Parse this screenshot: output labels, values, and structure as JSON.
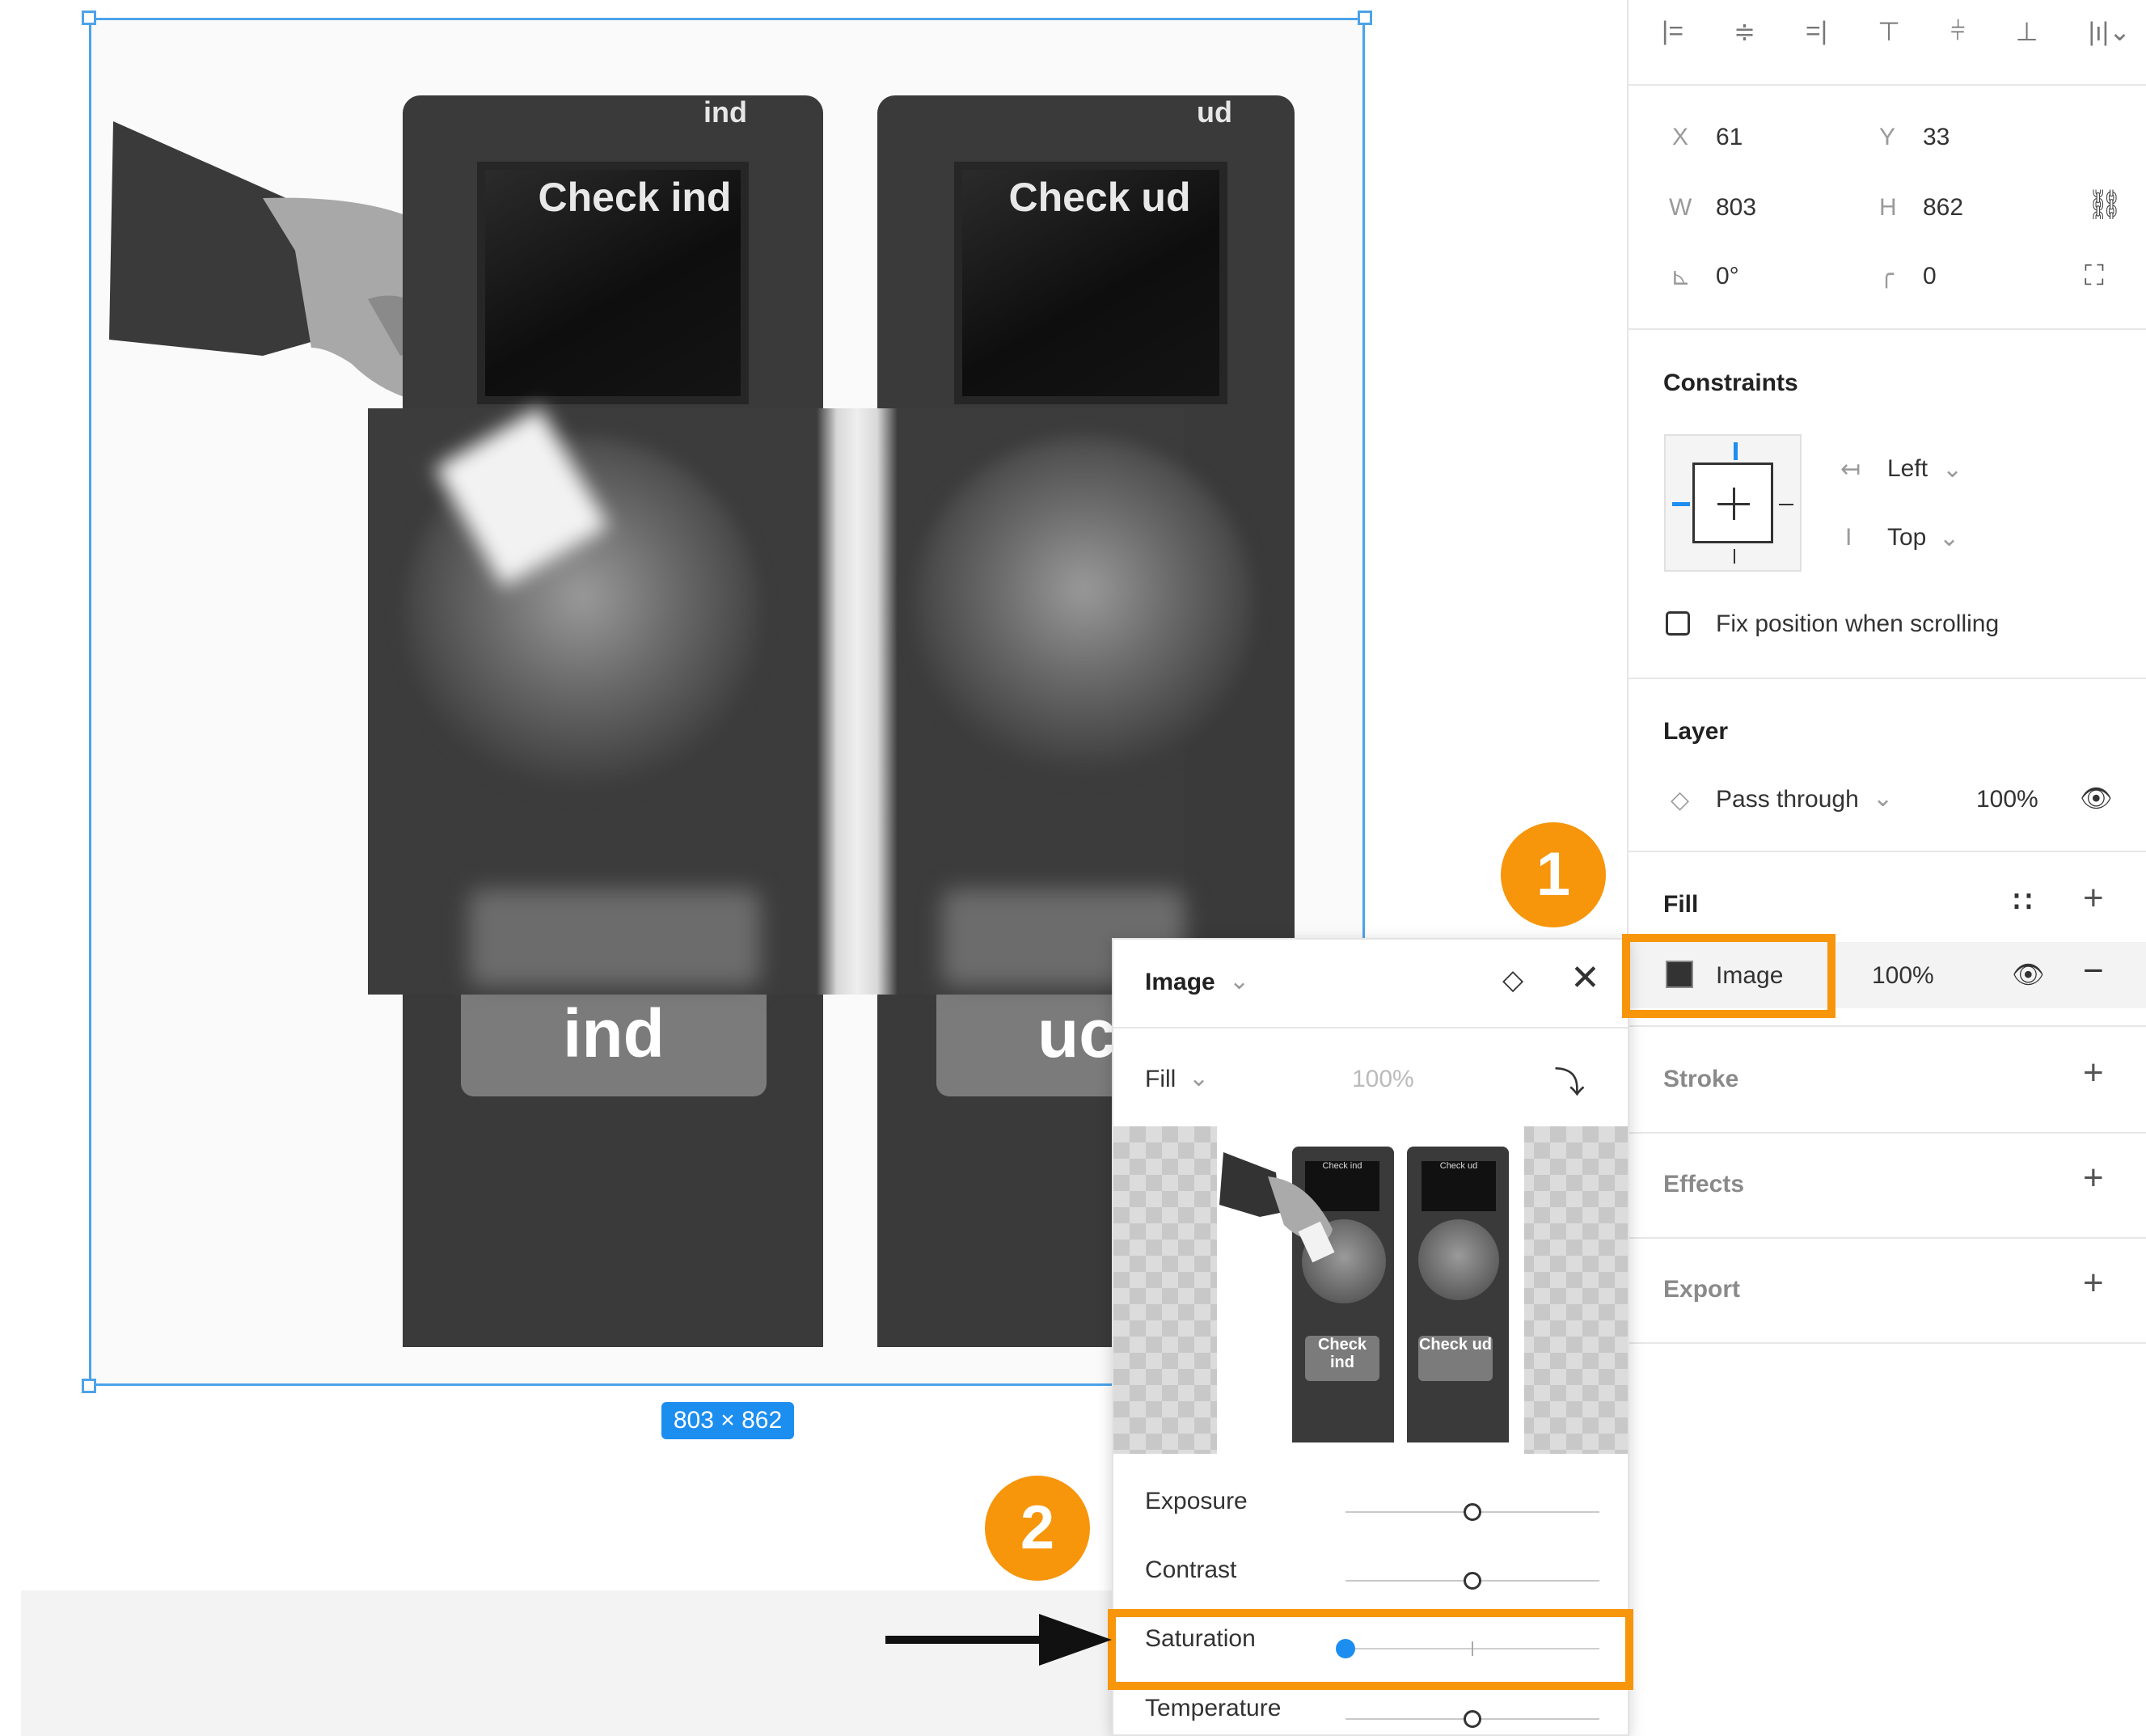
{
  "canvas": {
    "size_badge": "803 × 862",
    "artwork": {
      "left_kiosk": {
        "tag": "ind",
        "screen_text": "Check ind",
        "button_text": "ind"
      },
      "right_kiosk": {
        "tag": "ud",
        "screen_text": "Check ud",
        "button_text": "uc"
      }
    }
  },
  "panel": {
    "align_icons": [
      "align-left-icon",
      "align-h-center-icon",
      "align-right-icon",
      "align-top-icon",
      "align-v-center-icon",
      "align-bottom-icon",
      "distribute-icon"
    ],
    "geometry": {
      "x_label": "X",
      "x_value": "61",
      "y_label": "Y",
      "y_value": "33",
      "w_label": "W",
      "w_value": "803",
      "h_label": "H",
      "h_value": "862",
      "rotation_value": "0°",
      "radius_value": "0"
    },
    "constraints": {
      "title": "Constraints",
      "horizontal": "Left",
      "vertical": "Top",
      "fix_position_label": "Fix position when scrolling"
    },
    "layer": {
      "title": "Layer",
      "blend_mode": "Pass through",
      "opacity": "100%"
    },
    "fill": {
      "title": "Fill",
      "type": "Image",
      "opacity": "100%"
    },
    "stroke": {
      "title": "Stroke"
    },
    "effects": {
      "title": "Effects"
    },
    "export": {
      "title": "Export"
    }
  },
  "popover": {
    "title": "Image",
    "mode": "Fill",
    "mode_opacity": "100%",
    "preview": {
      "left_screen": "Check ind",
      "right_screen": "Check ud",
      "left_button": "Check ind",
      "right_button": "Check ud"
    },
    "adjustments": [
      {
        "label": "Exposure",
        "value": 0
      },
      {
        "label": "Contrast",
        "value": 0
      },
      {
        "label": "Saturation",
        "value": -100
      },
      {
        "label": "Temperature",
        "value": 0
      }
    ]
  },
  "annotations": {
    "badge_1": "1",
    "badge_2": "2",
    "accent_color": "#f7950b",
    "selection_color": "#4da3e8"
  }
}
